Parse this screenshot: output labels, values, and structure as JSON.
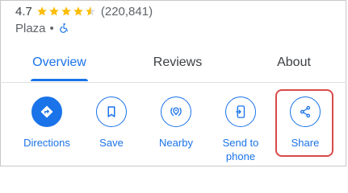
{
  "place": {
    "rating": "4.7",
    "review_count": "(220,841)",
    "category": "Plaza",
    "separator": "•",
    "accessibility_icon": "wheelchair-icon"
  },
  "tabs": [
    {
      "label": "Overview",
      "active": true
    },
    {
      "label": "Reviews",
      "active": false
    },
    {
      "label": "About",
      "active": false
    }
  ],
  "actions": [
    {
      "label": "Directions",
      "icon": "directions-icon"
    },
    {
      "label": "Save",
      "icon": "bookmark-icon"
    },
    {
      "label": "Nearby",
      "icon": "nearby-icon"
    },
    {
      "label": "Send to phone",
      "icon": "send-to-phone-icon"
    },
    {
      "label": "Share",
      "icon": "share-icon"
    }
  ],
  "colors": {
    "accent": "#1a73e8",
    "star": "#fbbc04",
    "highlight": "#d84a4a"
  }
}
